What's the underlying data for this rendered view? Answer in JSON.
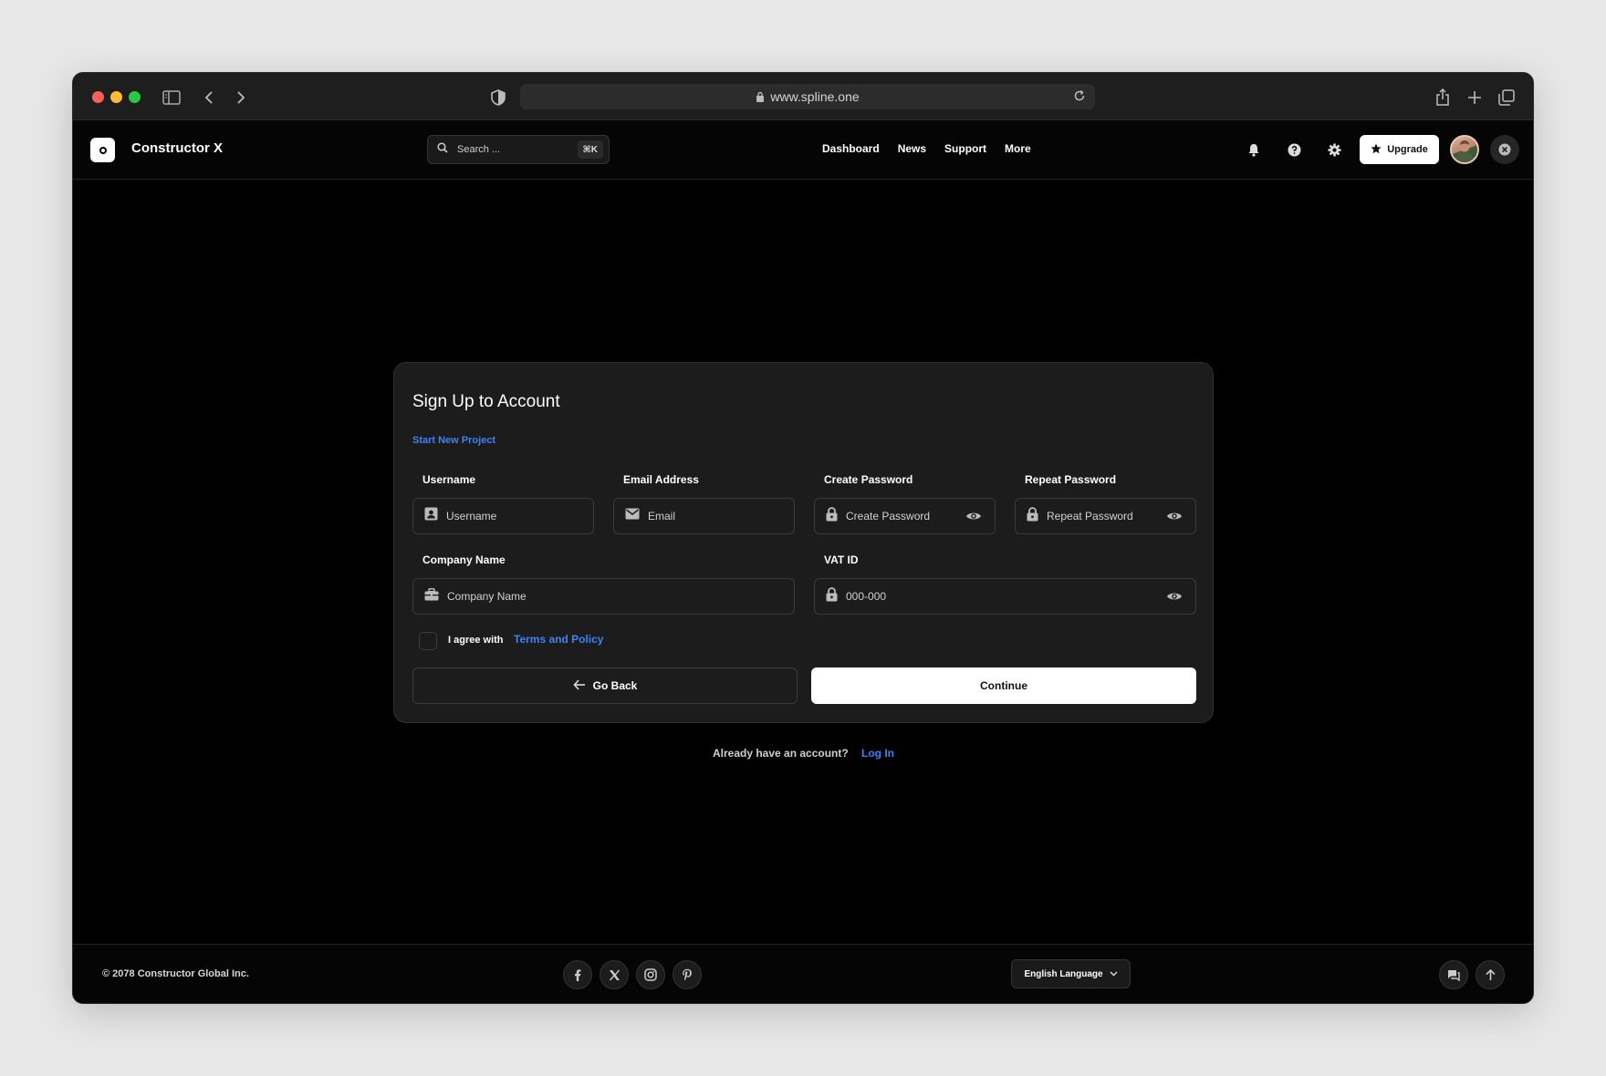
{
  "browser": {
    "url": "www.spline.one"
  },
  "header": {
    "app_title": "Constructor X",
    "search_placeholder": "Search ...",
    "search_shortcut": "⌘K",
    "nav": [
      "Dashboard",
      "News",
      "Support",
      "More"
    ],
    "upgrade_label": "Upgrade"
  },
  "form": {
    "title": "Sign Up to Account",
    "start_link": "Start New Project",
    "username": {
      "label": "Username",
      "placeholder": "Username"
    },
    "email": {
      "label": "Email Address",
      "placeholder": "Email"
    },
    "create_password": {
      "label": "Create Password",
      "placeholder": "Create Password"
    },
    "repeat_password": {
      "label": "Repeat Password",
      "placeholder": "Repeat Password"
    },
    "company": {
      "label": "Company Name",
      "placeholder": "Company Name"
    },
    "vat": {
      "label": "VAT ID",
      "placeholder": "000-000"
    },
    "agree_text": "I agree with",
    "terms_link": "Terms and Policy",
    "back_label": "Go Back",
    "continue_label": "Continue"
  },
  "account_prompt": {
    "text": "Already have an account?",
    "link": "Log In"
  },
  "footer": {
    "copyright": "© 2078 Constructor Global Inc.",
    "language": "English Language"
  },
  "colors": {
    "accent": "#3b82f6",
    "card_bg": "#1c1c1c",
    "page_bg": "#000000"
  }
}
